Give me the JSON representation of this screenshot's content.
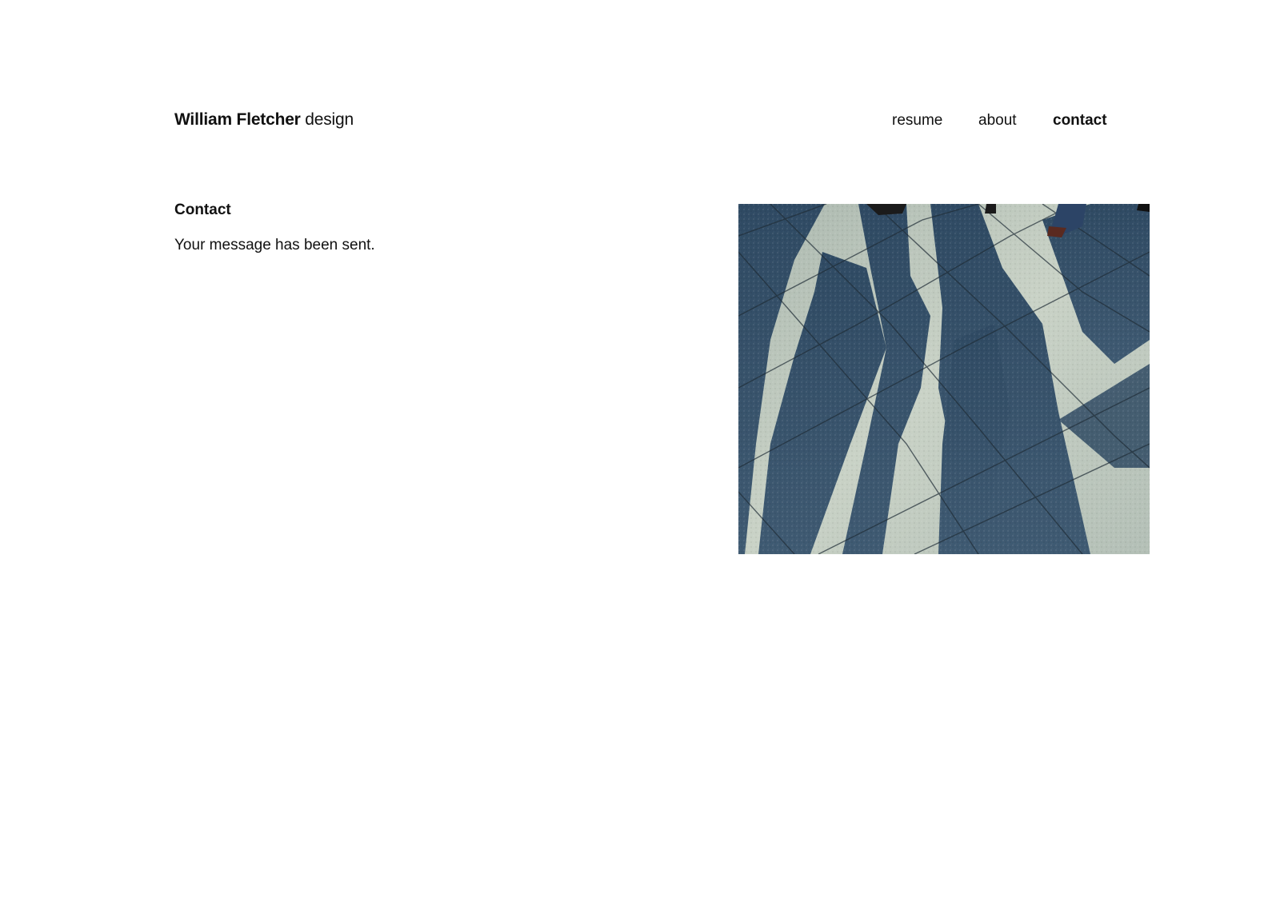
{
  "brand": {
    "name": "William Fletcher",
    "suffix": "design"
  },
  "nav": {
    "items": [
      {
        "label": "resume",
        "active": false
      },
      {
        "label": "about",
        "active": false
      },
      {
        "label": "contact",
        "active": true
      }
    ]
  },
  "main": {
    "heading": "Contact",
    "message": "Your message has been sent."
  },
  "colors": {
    "text": "#111111",
    "background": "#ffffff",
    "pavement_light": "#c9d2c6",
    "pavement_shadow": "#3f5a72"
  }
}
